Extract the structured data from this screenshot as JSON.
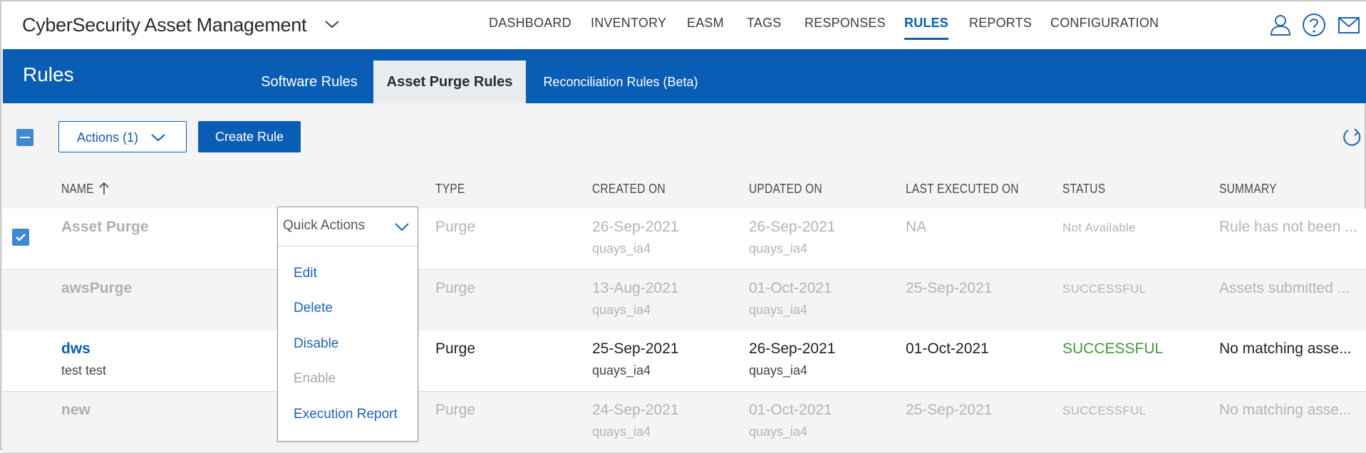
{
  "header": {
    "app_title": "CyberSecurity Asset Management",
    "nav": [
      {
        "label": "DASHBOARD",
        "active": false
      },
      {
        "label": "INVENTORY",
        "active": false
      },
      {
        "label": "EASM",
        "active": false
      },
      {
        "label": "TAGS",
        "active": false
      },
      {
        "label": "RESPONSES",
        "active": false
      },
      {
        "label": "RULES",
        "active": true
      },
      {
        "label": "REPORTS",
        "active": false
      },
      {
        "label": "CONFIGURATION",
        "active": false
      }
    ],
    "icons": [
      "user-icon",
      "help-icon",
      "mail-icon"
    ]
  },
  "band": {
    "title": "Rules",
    "tabs": [
      {
        "label": "Software Rules",
        "active": false
      },
      {
        "label": "Asset Purge Rules",
        "active": true
      },
      {
        "label": "Reconciliation Rules (Beta)",
        "active": false
      }
    ]
  },
  "toolbar": {
    "actions_label": "Actions (1)",
    "create_label": "Create Rule"
  },
  "table": {
    "columns": [
      "NAME",
      "TYPE",
      "CREATED ON",
      "UPDATED ON",
      "LAST EXECUTED ON",
      "STATUS",
      "SUMMARY"
    ],
    "sort_column": "NAME",
    "sort_direction": "ascending",
    "rows": [
      {
        "name": "Asset Purge",
        "description": "",
        "type": "Purge",
        "created": "26-Sep-2021",
        "created_by": "quays_ia4",
        "updated": "26-Sep-2021",
        "updated_by": "quays_ia4",
        "last_executed": "NA",
        "status": "Not Available",
        "summary": "Rule has not been ...",
        "selected": true,
        "enabled": false
      },
      {
        "name": "awsPurge",
        "description": "",
        "type": "Purge",
        "created": "13-Aug-2021",
        "created_by": "quays_ia4",
        "updated": "01-Oct-2021",
        "updated_by": "quays_ia4",
        "last_executed": "25-Sep-2021",
        "status": "SUCCESSFUL",
        "summary": "Assets submitted ...",
        "selected": false,
        "enabled": false
      },
      {
        "name": "dws",
        "description": "test test",
        "type": "Purge",
        "created": "25-Sep-2021",
        "created_by": "quays_ia4",
        "updated": "26-Sep-2021",
        "updated_by": "quays_ia4",
        "last_executed": "01-Oct-2021",
        "status": "SUCCESSFUL",
        "summary": "No matching asse...",
        "selected": false,
        "enabled": true
      },
      {
        "name": "new",
        "description": "",
        "type": "Purge",
        "created": "24-Sep-2021",
        "created_by": "quays_ia4",
        "updated": "01-Oct-2021",
        "updated_by": "quays_ia4",
        "last_executed": "25-Sep-2021",
        "status": "SUCCESSFUL",
        "summary": "No matching asse...",
        "selected": false,
        "enabled": false
      }
    ]
  },
  "quick_actions": {
    "label": "Quick Actions",
    "items": [
      {
        "label": "Edit",
        "disabled": false
      },
      {
        "label": "Delete",
        "disabled": false
      },
      {
        "label": "Disable",
        "disabled": false
      },
      {
        "label": "Enable",
        "disabled": true
      },
      {
        "label": "Execution Report",
        "disabled": false
      }
    ]
  },
  "colors": {
    "brand_blue": "#0a5db5",
    "checkbox_blue": "#3f88d2",
    "success_green": "#3f9a36",
    "muted_text": "#b4b4b4"
  }
}
